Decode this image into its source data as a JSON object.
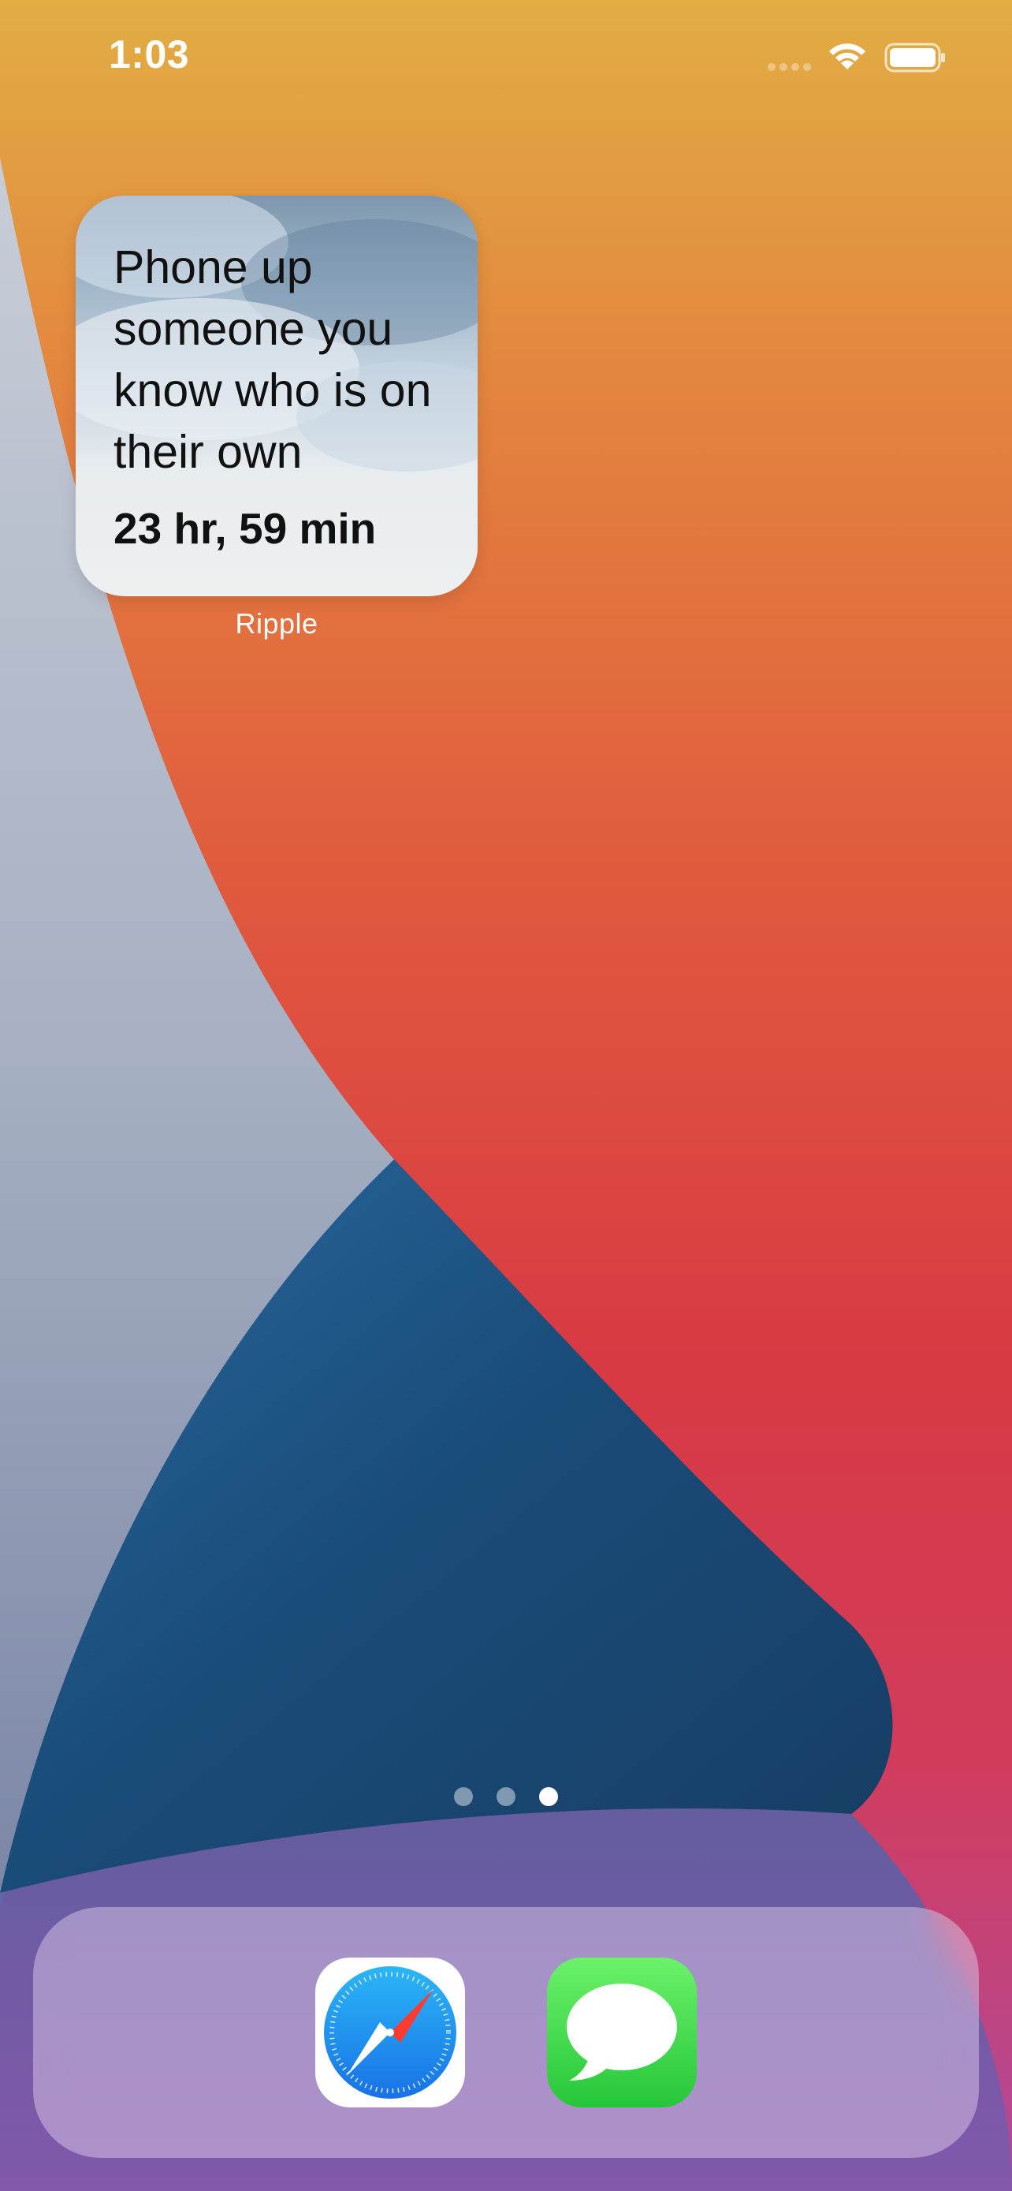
{
  "status_bar": {
    "time": "1:03"
  },
  "widget": {
    "prompt": "Phone up someone you know who is on their own",
    "timer": "23 hr, 59 min",
    "app_label": "Ripple"
  },
  "page_indicator": {
    "total": 3,
    "current": 3
  },
  "dock": {
    "apps": [
      {
        "name": "Safari",
        "icon": "safari-compass-icon"
      },
      {
        "name": "Messages",
        "icon": "speech-bubble-icon"
      }
    ]
  },
  "colors": {
    "wallpaper_orange": "#e2ad43",
    "wallpaper_red": "#d83a43",
    "wallpaper_blue": "#1d4f7c",
    "wallpaper_gray": "#aab4c4",
    "messages_green": "#34c759",
    "safari_blue": "#1a8cff"
  }
}
